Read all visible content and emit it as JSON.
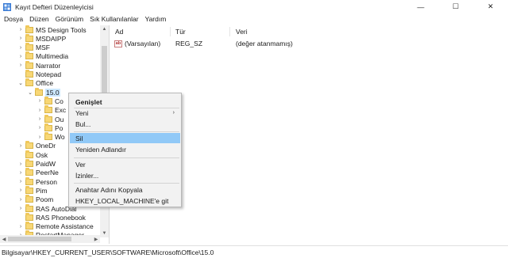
{
  "window": {
    "title": "Kayıt Defteri Düzenleyicisi",
    "app_icon": "regedit-icon",
    "controls": {
      "minimize": "—",
      "maximize": "☐",
      "close": "✕"
    }
  },
  "menu": [
    "Dosya",
    "Düzen",
    "Görünüm",
    "Sık Kullanılanlar",
    "Yardım"
  ],
  "tree": {
    "items": [
      {
        "label": "MS Design Tools",
        "chevron": "›"
      },
      {
        "label": "MSDAIPP",
        "chevron": "›"
      },
      {
        "label": "MSF",
        "chevron": "›"
      },
      {
        "label": "Multimedia",
        "chevron": "›"
      },
      {
        "label": "Narrator",
        "chevron": "›"
      },
      {
        "label": "Notepad",
        "chevron": ""
      },
      {
        "label": "Office",
        "chevron": "⌄"
      },
      {
        "label": "15.0",
        "chevron": "⌄"
      },
      {
        "label": "Co",
        "chevron": "›"
      },
      {
        "label": "Exc",
        "chevron": "›"
      },
      {
        "label": "Ou",
        "chevron": "›"
      },
      {
        "label": "Po",
        "chevron": "›"
      },
      {
        "label": "Wo",
        "chevron": "›"
      },
      {
        "label": "OneDr",
        "chevron": "›"
      },
      {
        "label": "Osk",
        "chevron": ""
      },
      {
        "label": "PaidW",
        "chevron": "›"
      },
      {
        "label": "PeerNe",
        "chevron": "›"
      },
      {
        "label": "Person",
        "chevron": "›"
      },
      {
        "label": "Pim",
        "chevron": "›"
      },
      {
        "label": "Poom",
        "chevron": "›"
      },
      {
        "label": "RAS AutoDial",
        "chevron": "›"
      },
      {
        "label": "RAS Phonebook",
        "chevron": ""
      },
      {
        "label": "Remote Assistance",
        "chevron": "›"
      },
      {
        "label": "RestartManager",
        "chevron": "›"
      }
    ],
    "scroll_up": "▲",
    "scroll_down": "▼",
    "scroll_left": "◀",
    "scroll_right": "▶"
  },
  "list": {
    "columns": [
      "Ad",
      "Tür",
      "Veri"
    ],
    "rows": [
      {
        "name": "(Varsayılan)",
        "type": "REG_SZ",
        "data": "(değer atanmamış)",
        "icon": "ab"
      }
    ]
  },
  "context_menu": {
    "items": [
      {
        "label": "Genişlet",
        "bold": true
      },
      {
        "label": "Yeni",
        "submenu": "›"
      },
      {
        "label": "Bul..."
      },
      {
        "label": "Sil",
        "highlighted": true
      },
      {
        "label": "Yeniden Adlandır"
      },
      {
        "label": "Ver"
      },
      {
        "label": "İzinler..."
      },
      {
        "label": "Anahtar Adını Kopyala"
      },
      {
        "label": "HKEY_LOCAL_MACHINE'e git"
      }
    ]
  },
  "status": {
    "path": "Bilgisayar\\HKEY_CURRENT_USER\\SOFTWARE\\Microsoft\\Office\\15.0"
  },
  "colors": {
    "selection": "#cce8ff",
    "menu_highlight": "#91c9f7",
    "folder": "#f8d775"
  }
}
